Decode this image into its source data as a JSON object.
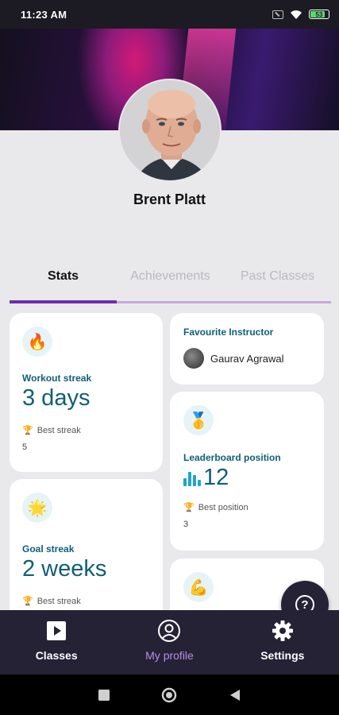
{
  "status_bar": {
    "time": "11:23 AM",
    "battery": "53"
  },
  "profile": {
    "name": "Brent Platt"
  },
  "tabs": [
    {
      "label": "Stats",
      "active": true
    },
    {
      "label": "Achievements",
      "active": false
    },
    {
      "label": "Past Classes",
      "active": false
    }
  ],
  "cards": {
    "workout_streak": {
      "icon": "fire-icon",
      "label": "Workout streak",
      "value": "3 days",
      "best_label": "Best streak",
      "best_value": "5"
    },
    "goal_streak": {
      "icon": "star-icon",
      "label": "Goal streak",
      "value": "2 weeks",
      "best_label": "Best streak"
    },
    "favourite_instructor": {
      "label": "Favourite Instructor",
      "name": "Gaurav Agrawal"
    },
    "leaderboard": {
      "icon": "medal-icon",
      "label": "Leaderboard position",
      "value": "12",
      "best_label": "Best position",
      "best_value": "3"
    },
    "strength": {
      "icon": "flexed-bicep-icon"
    }
  },
  "help": {
    "label": "?"
  },
  "nav": [
    {
      "label": "Classes",
      "icon": "play-icon",
      "active": false
    },
    {
      "label": "My profile",
      "icon": "user-circle-icon",
      "active": true
    },
    {
      "label": "Settings",
      "icon": "gear-icon",
      "active": false
    }
  ],
  "colors": {
    "accent": "#6f2db1",
    "stat_text": "#0f5e78",
    "nav_bg": "#252236",
    "active_nav": "#b98ee6"
  }
}
